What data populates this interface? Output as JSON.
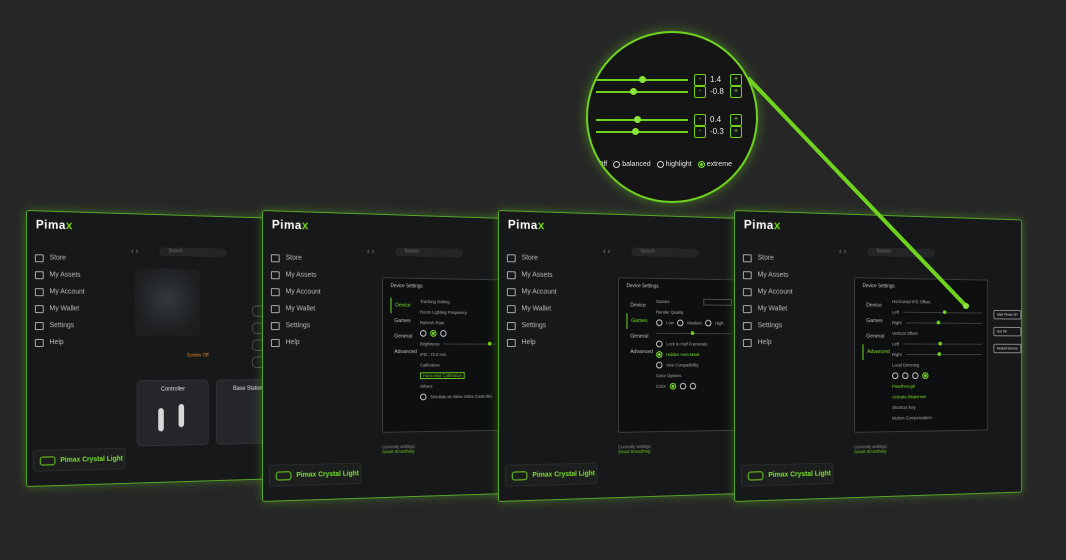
{
  "brand": {
    "name_main": "Pima",
    "name_x": "x",
    "accent": "#6fd21e"
  },
  "nav": [
    {
      "label": "Store",
      "icon": "store-icon"
    },
    {
      "label": "My Assets",
      "icon": "assets-icon"
    },
    {
      "label": "My Account",
      "icon": "account-icon"
    },
    {
      "label": "My Wallet",
      "icon": "wallet-icon"
    },
    {
      "label": "Settings",
      "icon": "settings-icon"
    },
    {
      "label": "Help",
      "icon": "help-icon"
    }
  ],
  "product": "Pimax Crystal Light",
  "search_placeholder": "Search",
  "screen1": {
    "screen_status": "Screen Off",
    "controller_label": "Controller",
    "base_station_label": "Base Station"
  },
  "dialog": {
    "title": "Device Settings",
    "tabs": [
      "Device",
      "Games",
      "General",
      "Advanced"
    ],
    "current_settings": "Currently settings:",
    "smart_smoothing": "Smart Smoothing"
  },
  "screen2": {
    "tracking_setting": "Tracking Setting",
    "room_lighting": "Room Lighting Frequency",
    "refresh_rate": "Refresh Rate",
    "brightness": "Brightness",
    "ipd": "IPD : 72.0 mm",
    "calibration": "Calibration",
    "calibrate_btn": "Horizontal Calibration",
    "others": "Others",
    "simulate": "Simulate as Valve Index Controller"
  },
  "screen3": {
    "games": "Games",
    "render_quality": "Render Quality",
    "quality_options": [
      "Low",
      "Medium",
      "High"
    ],
    "lock_fps": "Lock to Half Framerate",
    "hidden_area": "Hidden Area Mask",
    "vive_compat": "Vive Compatibility",
    "color_options": "Color Options",
    "color": "Color"
  },
  "screen4": {
    "h_ipd_offset": "Horizontal IPD Offset",
    "v_offset": "Vertical Offset",
    "left": "Left",
    "right": "Right",
    "local_dimming": "Local Dimming",
    "passthrough": "Passthrough",
    "activate_dispenser": "Activate Dispenser",
    "shortcut_key": "Shortcut Key",
    "motion_compensation": "Motion Compensation",
    "side_buttons": [
      "Start Pimax VR",
      "Get Tilt",
      "Restart Service"
    ]
  },
  "zoom": {
    "rows": [
      {
        "value": "1.4",
        "knob": 0.5
      },
      {
        "value": "-0.8",
        "knob": 0.4
      },
      {
        "value": "0.4",
        "knob": 0.45
      },
      {
        "value": "-0.3",
        "knob": 0.42
      }
    ],
    "minus": "-",
    "plus": "+",
    "dimming_options": [
      {
        "label": "Off",
        "selected": false
      },
      {
        "label": "balanced",
        "selected": false
      },
      {
        "label": "highlight",
        "selected": false
      },
      {
        "label": "extreme",
        "selected": true
      }
    ]
  }
}
